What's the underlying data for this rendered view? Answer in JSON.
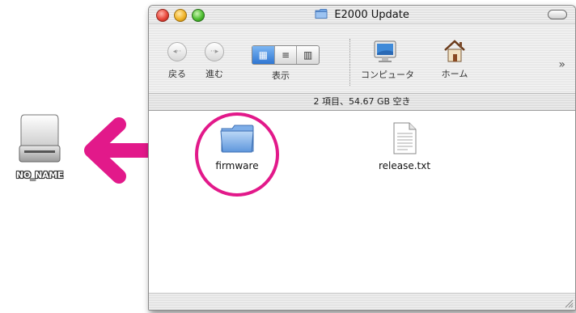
{
  "desktop": {
    "drive_label": "NO_NAME"
  },
  "window": {
    "title": "E2000 Update",
    "toolbar": {
      "back_label": "戻る",
      "forward_label": "進む",
      "view_label": "表示",
      "computer_label": "コンピュータ",
      "home_label": "ホーム",
      "more_glyph": "»"
    },
    "status": "2 項目、54.67 GB 空き",
    "files": [
      {
        "name": "firmware",
        "kind": "folder-icon"
      },
      {
        "name": "release.txt",
        "kind": "text-document-icon"
      }
    ]
  },
  "colors": {
    "highlight": "#e2198a",
    "window_border": "#8d8d8d"
  }
}
